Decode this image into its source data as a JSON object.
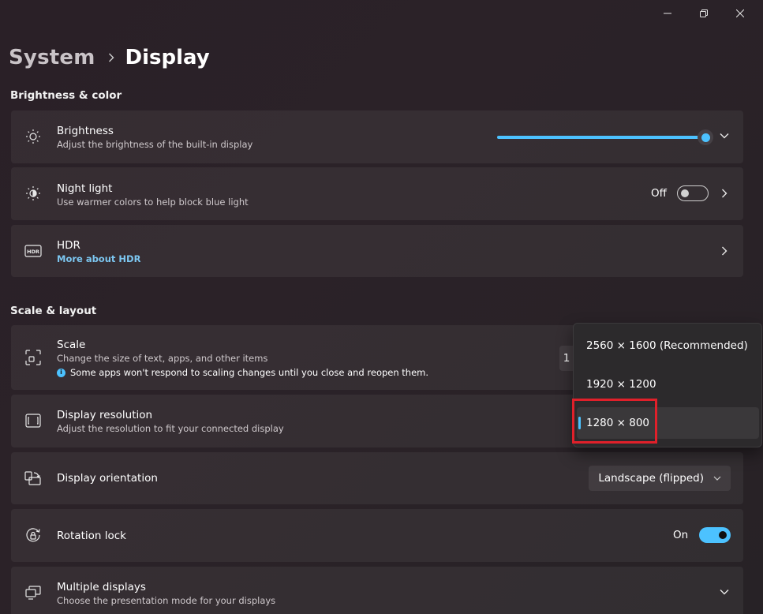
{
  "window": {
    "minimize_icon": "minimize-icon",
    "restore_icon": "restore-icon",
    "close_icon": "close-icon"
  },
  "breadcrumb": {
    "parent": "System",
    "current": "Display"
  },
  "sections": {
    "brightness_color": "Brightness & color",
    "scale_layout": "Scale & layout"
  },
  "brightness": {
    "title": "Brightness",
    "subtitle": "Adjust the brightness of the built-in display",
    "level": 1.0,
    "icon": "sun-icon"
  },
  "night_light": {
    "title": "Night light",
    "subtitle": "Use warmer colors to help block blue light",
    "state": "Off",
    "icon": "night-light-icon"
  },
  "hdr": {
    "title": "HDR",
    "link": "More about HDR",
    "icon": "hdr-icon"
  },
  "scale": {
    "title": "Scale",
    "subtitle": "Change the size of text, apps, and other items",
    "note": "Some apps won't respond to scaling changes until you close and reopen them.",
    "value_partial": "1",
    "icon": "scale-icon"
  },
  "display_resolution": {
    "title": "Display resolution",
    "subtitle": "Adjust the resolution to fit your connected display",
    "icon": "resolution-icon",
    "options": [
      "2560 × 1600 (Recommended)",
      "1920 × 1200",
      "1280 × 800"
    ],
    "selected": "1280 × 800"
  },
  "display_orientation": {
    "title": "Display orientation",
    "value": "Landscape (flipped)",
    "icon": "orientation-icon"
  },
  "rotation_lock": {
    "title": "Rotation lock",
    "state": "On",
    "icon": "rotation-lock-icon"
  },
  "multiple_displays": {
    "title": "Multiple displays",
    "subtitle": "Choose the presentation mode for your displays",
    "icon": "multiple-displays-icon"
  },
  "colors": {
    "accent": "#4cc2ff",
    "highlight": "#e0202a",
    "background": "#2a2027"
  }
}
